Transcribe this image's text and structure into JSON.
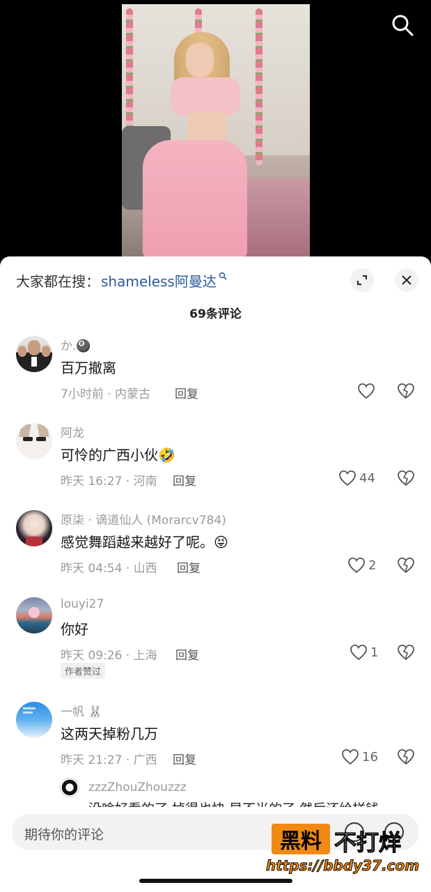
{
  "sheet": {
    "search_label": "大家都在搜：",
    "search_keyword": "shameless阿曼达",
    "count": "69条评论"
  },
  "comments": [
    {
      "name": "か.🎱",
      "text": "百万撤离",
      "meta": "7小时前 · 内蒙古",
      "reply": "回复",
      "likes": ""
    },
    {
      "name": "阿龙",
      "text": "可怜的广西小伙🤣",
      "meta": "昨天 16:27 · 河南",
      "reply": "回复",
      "likes": "44"
    },
    {
      "name": "原柒 · 谪道仙人 (Morarcv784)",
      "text": "感觉舞蹈越来越好了呢。😝",
      "meta": "昨天 04:54 · 山西",
      "reply": "回复",
      "likes": "2"
    },
    {
      "name": "louyi27",
      "text": "你好",
      "meta": "昨天 09:26 · 上海",
      "reply": "回复",
      "likes": "1",
      "badge": "作者赞过"
    },
    {
      "name": "一帆 🐰",
      "text": "这两天掉粉几万",
      "meta": "昨天 21:27 · 广西",
      "reply": "回复",
      "likes": "16"
    }
  ],
  "sub_reply": {
    "name": "zzzZhouZhouzzz",
    "text": "没啥好看的了 掉得也快 早不当的了 然后还给样钱"
  },
  "input": {
    "placeholder": "期待你的评论"
  },
  "watermark": {
    "brand1": "黑料",
    "brand2": "不打烊",
    "url": "https://bbdy37.com"
  },
  "icons": {
    "search": "search-icon",
    "expand": "expand-icon",
    "close": "close-icon",
    "like": "heart-icon",
    "dislike": "broken-heart-icon"
  }
}
